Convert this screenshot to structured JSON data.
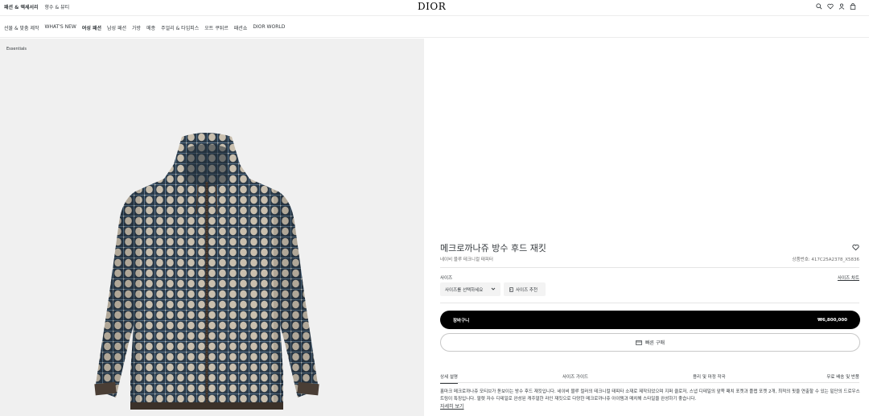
{
  "topbar": {
    "tabs": [
      {
        "label": "패션 & 액세서리",
        "active": true
      },
      {
        "label": "향수 & 뷰티",
        "active": false
      }
    ],
    "logo": "DIOR",
    "icons": [
      "search-icon",
      "heart-icon",
      "user-icon",
      "bag-icon"
    ]
  },
  "nav": {
    "items": [
      {
        "label": "선물 & 맞춤 제작",
        "active": false
      },
      {
        "label": "WHAT'S NEW",
        "active": false
      },
      {
        "label": "여성 패션",
        "active": true
      },
      {
        "label": "남성 패션",
        "active": false
      },
      {
        "label": "가방",
        "active": false
      },
      {
        "label": "메종",
        "active": false
      },
      {
        "label": "주얼리 & 타임피스",
        "active": false
      },
      {
        "label": "오트 쿠튀르",
        "active": false
      },
      {
        "label": "패션쇼",
        "active": false
      },
      {
        "label": "DIOR WORLD",
        "active": false
      }
    ]
  },
  "breadcrumb": "Essentials",
  "product": {
    "title": "메크로까나쥬 방수 후드 재킷",
    "subtitle": "네이비 블루 테크니컬 태피터",
    "reference": "상품번호: 417C25A2378_X5836",
    "size_label": "사이즈",
    "size_guide": "사이즈 차트",
    "size_select": "사이즈를 선택하세요",
    "size_reco": "사이즈 추천",
    "cart_label": "장바구니",
    "price": "₩6,800,000",
    "quick_buy": "빠른 구매",
    "tabs": [
      "상세 설명",
      "사이즈 가이드",
      "용리 및 마정 작곡",
      "무료 배송 및 반품"
    ],
    "description": "홀마크 메크로까나쥬 모티브가 돋보이는 방수 후드 재킷입니다. 네이비 블루 컬러의 테크니컬 태피타 소재로 제작되었으며 지퍼 클로저, 스냅 디테일의 앞쪽 패치 포켓과 플랩 포켓 2개, 최적의 핏을 연출할 수 있는 밑단의 드로우스트링이 특징입니다. 팔렛 자수 디테일로 완성된 캐주얼한 라인 재킷으로 다양한 메크로까나쥬 아이템과 매치해 스타일을 완성하기 좋습니다.",
    "more": "자세히 보기"
  },
  "colors": {
    "navy": "#2b3a48",
    "beige": "#c9bfae",
    "accent": "#000000"
  }
}
